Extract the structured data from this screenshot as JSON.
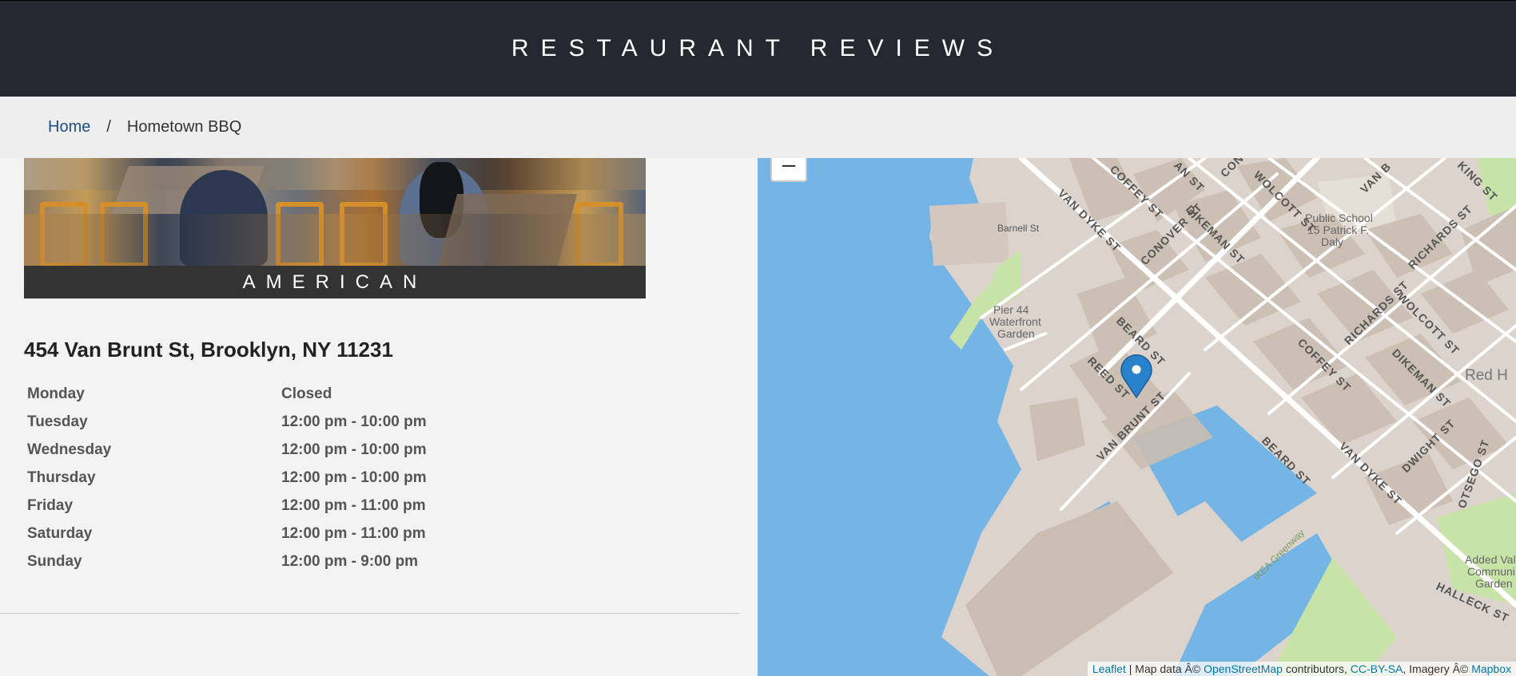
{
  "header": {
    "title": "RESTAURANT REVIEWS"
  },
  "breadcrumb": {
    "home": "Home",
    "separator": "/",
    "current": "Hometown BBQ"
  },
  "restaurant": {
    "cuisine": "AMERICAN",
    "address": "454 Van Brunt St, Brooklyn, NY 11231",
    "hours": [
      {
        "day": "Monday",
        "time": "Closed"
      },
      {
        "day": "Tuesday",
        "time": "12:00 pm - 10:00 pm"
      },
      {
        "day": "Wednesday",
        "time": "12:00 pm - 10:00 pm"
      },
      {
        "day": "Thursday",
        "time": "12:00 pm - 10:00 pm"
      },
      {
        "day": "Friday",
        "time": "12:00 pm - 11:00 pm"
      },
      {
        "day": "Saturday",
        "time": "12:00 pm - 11:00 pm"
      },
      {
        "day": "Sunday",
        "time": "12:00 pm - 9:00 pm"
      }
    ]
  },
  "map": {
    "zoom_out": "−",
    "labels": {
      "barnell": "Barnell St",
      "pier44_1": "Pier 44",
      "pier44_2": "Waterfront",
      "pier44_3": "Garden",
      "coffey1": "COFFEY ST",
      "van_dyke1": "VAN DYKE ST",
      "conover": "CONOVER ST",
      "dikeman1": "DIKEMAN ST",
      "wolcott1": "WOLCOTT ST",
      "school1": "Public School",
      "school2": "15 Patrick F.",
      "school3": "Daly",
      "richards1": "RICHARDS ST",
      "richards2": "RICHARDS ST",
      "wolcott2": "WOLCOTT ST",
      "beard1": "BEARD ST",
      "reed": "REED ST",
      "van_brunt": "VAN BRUNT ST",
      "coffey2": "COFFEY ST",
      "dikeman2": "DIKEMAN ST",
      "red_hook": "Red H",
      "beard2": "BEARD ST",
      "van_dyke2": "VAN DYKE ST",
      "dwight": "DWIGHT ST",
      "otsego": "OTSEGO ST",
      "ikea": "IKEA Greenway",
      "added1": "Added Valu",
      "added2": "Communi",
      "added3": "Garden",
      "halleck": "HALLECK ST",
      "king": "KING ST",
      "van_b_top": "VAN B",
      "an_st": "AN ST",
      "con_top": "CON"
    },
    "attribution": {
      "leaflet": "Leaflet",
      "map_data": " | Map data Â© ",
      "osm": "OpenStreetMap",
      "contributors": " contributors, ",
      "ccbysa": "CC-BY-SA",
      "imagery": ", Imagery Â© ",
      "mapbox": "Mapbox"
    },
    "colors": {
      "water": "#75b5e6",
      "land": "#d9d0c9",
      "park": "#c8e3a8",
      "marker": "#2a81cb"
    }
  }
}
